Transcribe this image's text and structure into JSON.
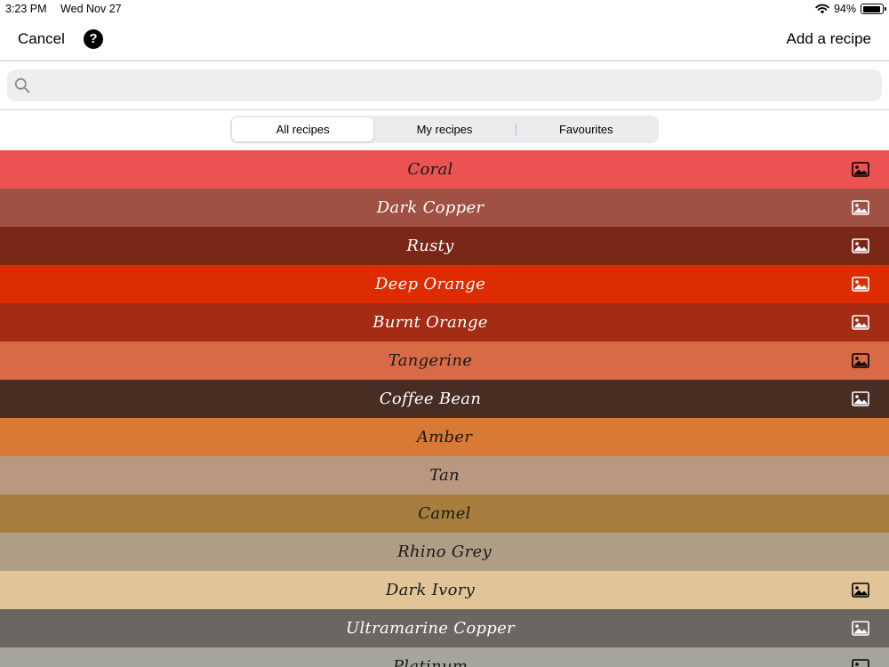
{
  "status": {
    "time": "3:23 PM",
    "date": "Wed Nov 27",
    "battery": "94%"
  },
  "nav": {
    "cancel": "Cancel",
    "help": "?",
    "add": "Add a recipe"
  },
  "search": {
    "placeholder": ""
  },
  "tabs": [
    {
      "label": "All recipes",
      "selected": true
    },
    {
      "label": "My recipes",
      "selected": false
    },
    {
      "label": "Favourites",
      "selected": false
    }
  ],
  "recipes": [
    {
      "name": "Coral",
      "color": "#eb5252",
      "text": "#1a1a1a",
      "image": true
    },
    {
      "name": "Dark Copper",
      "color": "#a05144",
      "text": "#ffffff",
      "image": true
    },
    {
      "name": "Rusty",
      "color": "#7b2718",
      "text": "#ffffff",
      "image": true
    },
    {
      "name": "Deep Orange",
      "color": "#dc2c00",
      "text": "#ffffff",
      "image": true
    },
    {
      "name": "Burnt Orange",
      "color": "#a42c14",
      "text": "#ffffff",
      "image": true
    },
    {
      "name": "Tangerine",
      "color": "#d86a45",
      "text": "#1a1a1a",
      "image": true
    },
    {
      "name": "Coffee Bean",
      "color": "#472d22",
      "text": "#ffffff",
      "image": true
    },
    {
      "name": "Amber",
      "color": "#d87a35",
      "text": "#1a1a1a",
      "image": false
    },
    {
      "name": "Tan",
      "color": "#ba9880",
      "text": "#1a1a1a",
      "image": false
    },
    {
      "name": "Camel",
      "color": "#a67d3d",
      "text": "#1a1a1a",
      "image": false
    },
    {
      "name": "Rhino Grey",
      "color": "#ad9e85",
      "text": "#1a1a1a",
      "image": false
    },
    {
      "name": "Dark Ivory",
      "color": "#e1c598",
      "text": "#1a1a1a",
      "image": true
    },
    {
      "name": "Ultramarine Copper",
      "color": "#6b6661",
      "text": "#ffffff",
      "image": true
    },
    {
      "name": "Platinum",
      "color": "#a5a59b",
      "text": "#1a1a1a",
      "image": true
    }
  ]
}
